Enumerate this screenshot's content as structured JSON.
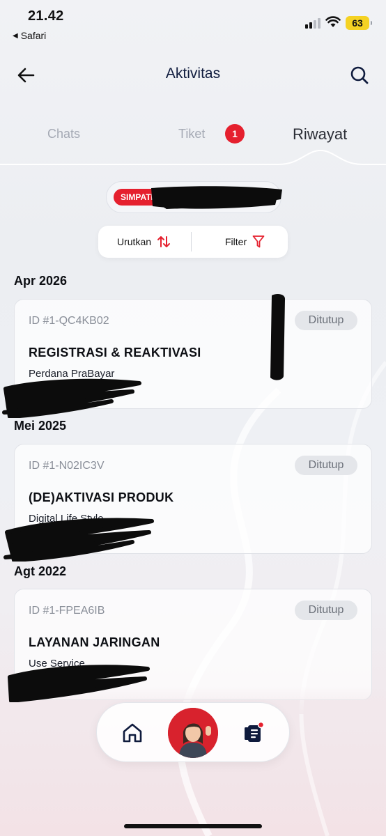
{
  "status_bar": {
    "time": "21.42",
    "back_app": "Safari",
    "battery": "63"
  },
  "header": {
    "title": "Aktivitas",
    "back_icon": "arrow-left-icon",
    "search_icon": "search-icon"
  },
  "tabs": {
    "items": [
      {
        "label": "Chats",
        "active": false
      },
      {
        "label": "Tiket",
        "active": false,
        "badge": "1"
      },
      {
        "label": "Riwayat",
        "active": true
      }
    ]
  },
  "number_chip": {
    "tag": "SIMPATI"
  },
  "toolbar": {
    "sort_label": "Urutkan",
    "filter_label": "Filter",
    "sort_icon": "sort-arrows-icon",
    "filter_icon": "filter-funnel-icon"
  },
  "sections": [
    {
      "month": "Apr 2026",
      "ticket": {
        "id": "ID #1-QC4KB02",
        "status": "Ditutup",
        "title": "REGISTRASI & REAKTIVASI",
        "subtitle": "Perdana PraBayar"
      }
    },
    {
      "month": "Mei 2025",
      "ticket": {
        "id": "ID #1-N02IC3V",
        "status": "Ditutup",
        "title": "(DE)AKTIVASI PRODUK",
        "subtitle": "Digital Life Style"
      }
    },
    {
      "month": "Agt 2022",
      "ticket": {
        "id": "ID #1-FPEA6IB",
        "status": "Ditutup",
        "title": "LAYANAN JARINGAN",
        "subtitle": "Use Service"
      }
    }
  ],
  "bottom_nav": {
    "items": [
      "home-icon",
      "assistant-avatar",
      "activity-list-icon"
    ]
  },
  "colors": {
    "accent_red": "#e5202e",
    "title_navy": "#0f1b3d",
    "status_pill_bg": "#e4e6ea"
  }
}
